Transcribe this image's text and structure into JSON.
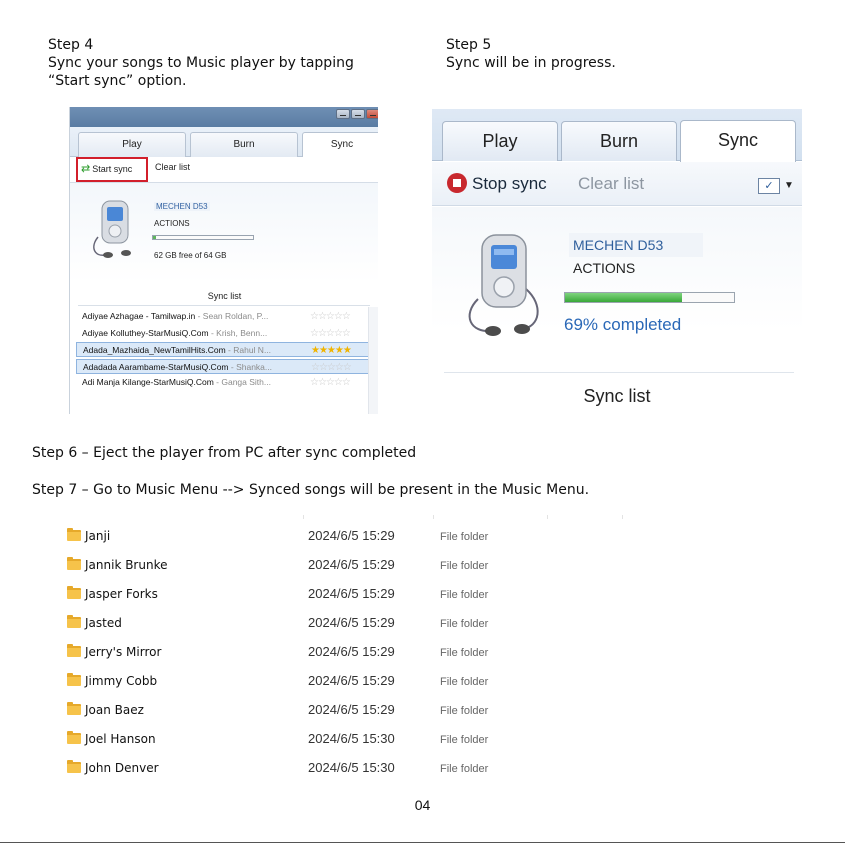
{
  "steps": {
    "step4": {
      "heading": "Step 4",
      "line1": "Sync your songs to Music player by tapping",
      "line2": "“Start sync” option."
    },
    "step5": {
      "heading": "Step 5",
      "line1": "Sync will be in progress."
    },
    "step6": "Step 6 – Eject the player from PC after sync completed",
    "step7": "Step 7 – Go to Music Menu --> Synced songs will be present in the Music Menu."
  },
  "screenshot_step4": {
    "tabs": [
      "Play",
      "Burn",
      "Sync"
    ],
    "active_tab": "Sync",
    "start_sync_label": "Start sync",
    "clear_list_label": "Clear list",
    "device_name": "MECHEN D53",
    "device_manufacturer": "ACTIONS",
    "free_space": "62 GB free of 64 GB",
    "capacity_used_fraction": 0.03,
    "sync_list_title": "Sync list",
    "songs": [
      {
        "title": "Adiyae Azhagae - Tamilwap.in",
        "artist": " - Sean Roldan, P...",
        "rating": 0,
        "selected": false
      },
      {
        "title": "Adiyae Kolluthey-StarMusiQ.Com",
        "artist": " - Krish, Benn...",
        "rating": 0,
        "selected": false
      },
      {
        "title": "Adada_Mazhaida_NewTamilHits.Com",
        "artist": " - Rahul N...",
        "rating": 5,
        "selected": true
      },
      {
        "title": "Adadada Aarambame-StarMusiQ.Com",
        "artist": " - Shanka...",
        "rating": 0,
        "selected": true
      },
      {
        "title": "Adi Manja Kilange-StarMusiQ.Com",
        "artist": " - Ganga Sith...",
        "rating": 0,
        "selected": false
      }
    ],
    "accent_color": "#d21f2b"
  },
  "screenshot_step5": {
    "tabs": [
      "Play",
      "Burn",
      "Sync"
    ],
    "active_tab": "Sync",
    "stop_sync_label": "Stop sync",
    "clear_list_label": "Clear list",
    "device_name": "MECHEN D53",
    "device_manufacturer": "ACTIONS",
    "progress_percent": 69,
    "progress_text": "69% completed",
    "sync_list_title": "Sync list"
  },
  "folders": [
    {
      "name": "Janji",
      "date": "2024/6/5 15:29",
      "type": "File folder"
    },
    {
      "name": "Jannik Brunke",
      "date": "2024/6/5 15:29",
      "type": "File folder"
    },
    {
      "name": "Jasper Forks",
      "date": "2024/6/5 15:29",
      "type": "File folder"
    },
    {
      "name": "Jasted",
      "date": "2024/6/5 15:29",
      "type": "File folder"
    },
    {
      "name": "Jerry's Mirror",
      "date": "2024/6/5 15:29",
      "type": "File folder"
    },
    {
      "name": "Jimmy Cobb",
      "date": "2024/6/5 15:29",
      "type": "File folder"
    },
    {
      "name": "Joan Baez",
      "date": "2024/6/5 15:29",
      "type": "File folder"
    },
    {
      "name": "Joel Hanson",
      "date": "2024/6/5 15:30",
      "type": "File folder"
    },
    {
      "name": "John Denver",
      "date": "2024/6/5 15:30",
      "type": "File folder"
    }
  ],
  "page_number": "04"
}
